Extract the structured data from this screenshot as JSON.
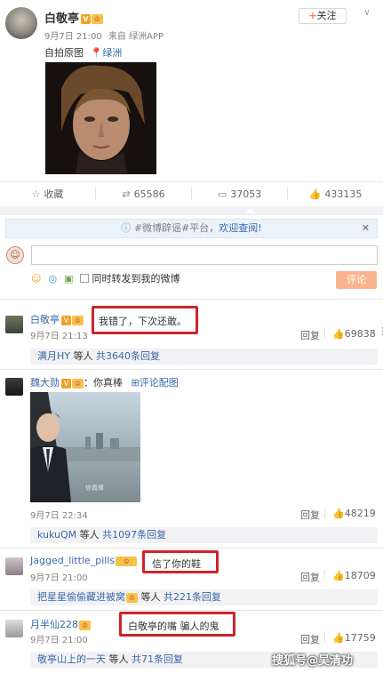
{
  "post": {
    "author": "白敬亭",
    "time": "9月7日 21:00",
    "source": "来自 绿洲APP",
    "text": "自拍原图",
    "location": "绿洲",
    "follow": "关注"
  },
  "actions": {
    "collect": "收藏",
    "repost": "65586",
    "comment": "37053",
    "like": "433135"
  },
  "notice": {
    "text": "#微博辟谣#平台，",
    "link": "欢迎查阅!"
  },
  "composer": {
    "also_repost": "同时转发到我的微博",
    "submit": "评论"
  },
  "comments": [
    {
      "user": "白敬亭",
      "text": "我错了，下次还敢。",
      "time": "9月7日 21:13",
      "reply": "回复",
      "likes": "69838",
      "sub_user": "满月HY",
      "sub_mid": "等人",
      "sub_count": "共3640条回复"
    },
    {
      "user": "魏大勋",
      "text": "：你真棒",
      "pic_label": "评论配图",
      "img_caption": "你真棒",
      "time": "9月7日 22:34",
      "reply": "回复",
      "likes": "48219",
      "sub_user": "kukuQM",
      "sub_mid": "等人",
      "sub_count": "共1097条回复"
    },
    {
      "user": "Jagged_little_pills",
      "text": "信了你的鞋",
      "time": "9月7日 21:00",
      "reply": "回复",
      "likes": "18709",
      "sub_user": "把星星偷偷藏进被窝",
      "sub_mid": "等人",
      "sub_count": "共221条回复"
    },
    {
      "user": "月半仙228",
      "text": "白敬亭的嘴 骗人的鬼",
      "time": "9月7日 21:00",
      "reply": "回复",
      "likes": "17759",
      "sub_user": "敬亭山上的一天",
      "sub_mid": "等人",
      "sub_count": "共71条回复"
    }
  ],
  "watermark": "搜狐号@吴清功"
}
